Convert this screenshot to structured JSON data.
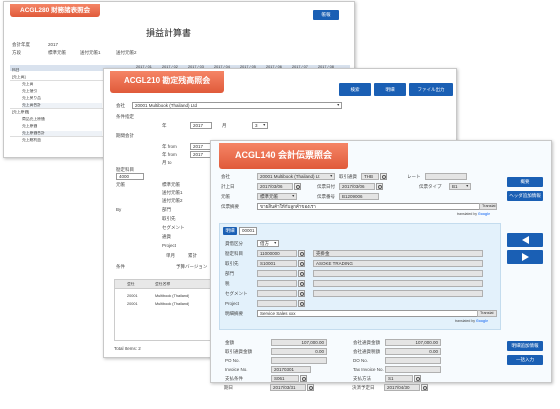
{
  "win1": {
    "title": "ACGL280 財務諸表照会",
    "action_btn": "帳報",
    "heading": "損益計算書",
    "filters": [
      {
        "label": "会計年度",
        "value": "2017"
      },
      {
        "label": "方段",
        "value": "標準元帳"
      },
      {
        "label": "送付元帳1",
        "value": ""
      },
      {
        "label": "送付元帳2",
        "value": ""
      }
    ],
    "col_header": [
      "2017 / 01",
      "2017 / 02",
      "2017 / 03",
      "2017 / 04",
      "2017 / 05",
      "2017 / 06",
      "2017 / 07",
      "2017 / 08"
    ],
    "rows": [
      "科目",
      "[売上高]",
      "売上高",
      "売上値引",
      "売上戻り品",
      "売上高合計",
      "[売上原価]",
      "商品売上原価",
      "売上原価",
      "売上原価合計",
      "売上総利益"
    ]
  },
  "win2": {
    "title": "ACGL210 勘定残高照会",
    "btn_search": "検索",
    "btn_detail": "明細",
    "btn_export": "ファイル出力",
    "company_label": "会社",
    "company_value": "20001 Multibook (Thailand) Ltd",
    "period_label": "条件指定",
    "year_label": "年",
    "year_value": "2017",
    "month_label": "月",
    "month_value": "3",
    "period_type_label": "期間会計",
    "from_label": "年 from",
    "from_value": "2017",
    "to_label": "年 from",
    "to_value": "2017",
    "month_to_label": "月 to",
    "account_label": "勘定科目",
    "account_value": "4000",
    "ledger_label": "元帳",
    "ledger_items": [
      "標準元帳",
      "送付元帳1",
      "送付元帳2"
    ],
    "by_label": "By",
    "by_items": [
      "部門",
      "取引先",
      "セグメント",
      "通貨",
      "Project"
    ],
    "radio_a": "単月",
    "radio_b": "累計",
    "cond_label": "条件",
    "version_label": "予算バージョン",
    "table_headers": [
      "会社",
      "会社名称"
    ],
    "table_rows": [
      {
        "code": "20001",
        "name": "Multibook (Thailand)"
      },
      {
        "code": "20001",
        "name": "Multibook (Thailand)"
      }
    ],
    "total": "Total Items: 2"
  },
  "win3": {
    "title": "ACGL140 会計伝票照会",
    "btn_summary": "概要",
    "btn_header_info": "ヘッダ追加情報",
    "btn_line_info": "明細追加情報",
    "btn_one_entry": "一括入力",
    "header": {
      "company_label": "会社",
      "company_value": "20001 Multibook (Thailand) Lt",
      "currency_label": "取引通貨",
      "currency_value": "THB",
      "rate_label": "レート",
      "rate_value": "",
      "post_date_label": "計上日",
      "post_date_value": "2017/03/06",
      "doc_date_label": "伝票日付",
      "doc_date_value": "2017/03/06",
      "doc_type_label": "伝票タイプ",
      "doc_type_value": "B1",
      "ledger_label": "元帳",
      "ledger_value": "標準元帳",
      "doc_no_label": "伝票番号",
      "doc_no_value": "B1209006",
      "summary_label": "伝票摘要",
      "summary_value": "ขายสินค้าให้กับลูกค้าของเรา",
      "translate_btn": "Translat",
      "translated_by": "translated by",
      "google": "Google"
    },
    "line": {
      "tab_label": "明細",
      "line_no": "00001",
      "dc_label": "貸借区分",
      "dc_value": "借方",
      "account_label": "勘定科目",
      "account_value": "11000000",
      "account_name": "売掛金",
      "partner_label": "取引先",
      "partner_value": "S10001",
      "partner_name": "ASOKE TRADING",
      "dept_label": "部門",
      "tax_label": "税",
      "segment_label": "セグメント",
      "project_label": "Project",
      "desc_label": "明細摘要",
      "desc_value": "Service Sales xxx",
      "translate_btn": "Translat",
      "translated_by": "translated by",
      "google": "Google"
    },
    "amounts": {
      "amount_label": "金額",
      "amount_value": "107,000.00",
      "tx_amount_label": "取引通貨金額",
      "tx_amount_value": "0.00",
      "co_amount_label": "会社通貨金額",
      "co_amount_value": "107,000.00",
      "co_tax_label": "会社通貨税額",
      "co_tax_value": "0.00",
      "po_label": "PO No.",
      "do_label": "DO No.",
      "invoice_label": "Invoice No.",
      "invoice_value": "20170301",
      "tax_invoice_label": "Tax Invoice No.",
      "pay_cond_label": "支払条件",
      "pay_cond_value": "S061",
      "pay_method_label": "支払方法",
      "pay_method_value": "S1",
      "due_label": "期日",
      "due_value": "2017/03/31",
      "settle_label": "決済予定日",
      "settle_value": "2017/04/30"
    }
  },
  "colors": {
    "title_orange": "#e8663f",
    "button_blue": "#1a5fb4",
    "panel_blue": "#e3f1fb"
  }
}
